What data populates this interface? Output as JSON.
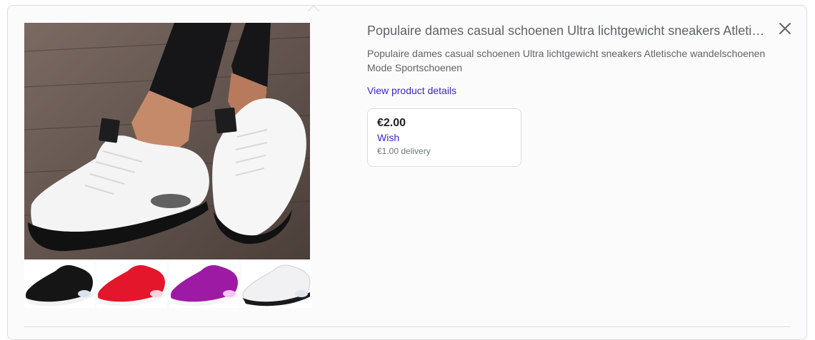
{
  "product": {
    "title": "Populaire dames casual schoenen Ultra lichtgewicht sneakers Atletische wandelschoenen Mode Sportschoenen",
    "description": "Populaire dames casual schoenen Ultra lichtgewicht sneakers Atletische wandelschoenen Mode Sportschoenen",
    "details_link": "View product details"
  },
  "offer": {
    "price": "€2.00",
    "merchant": "Wish",
    "delivery": "€1.00 delivery"
  },
  "thumbnails": [
    {
      "color_name": "black",
      "color": "#151515"
    },
    {
      "color_name": "red",
      "color": "#e3162b"
    },
    {
      "color_name": "purple",
      "color": "#9d1aa5"
    },
    {
      "color_name": "white",
      "color": "#f1f1f3"
    }
  ],
  "icons": {
    "close": "close-icon"
  }
}
